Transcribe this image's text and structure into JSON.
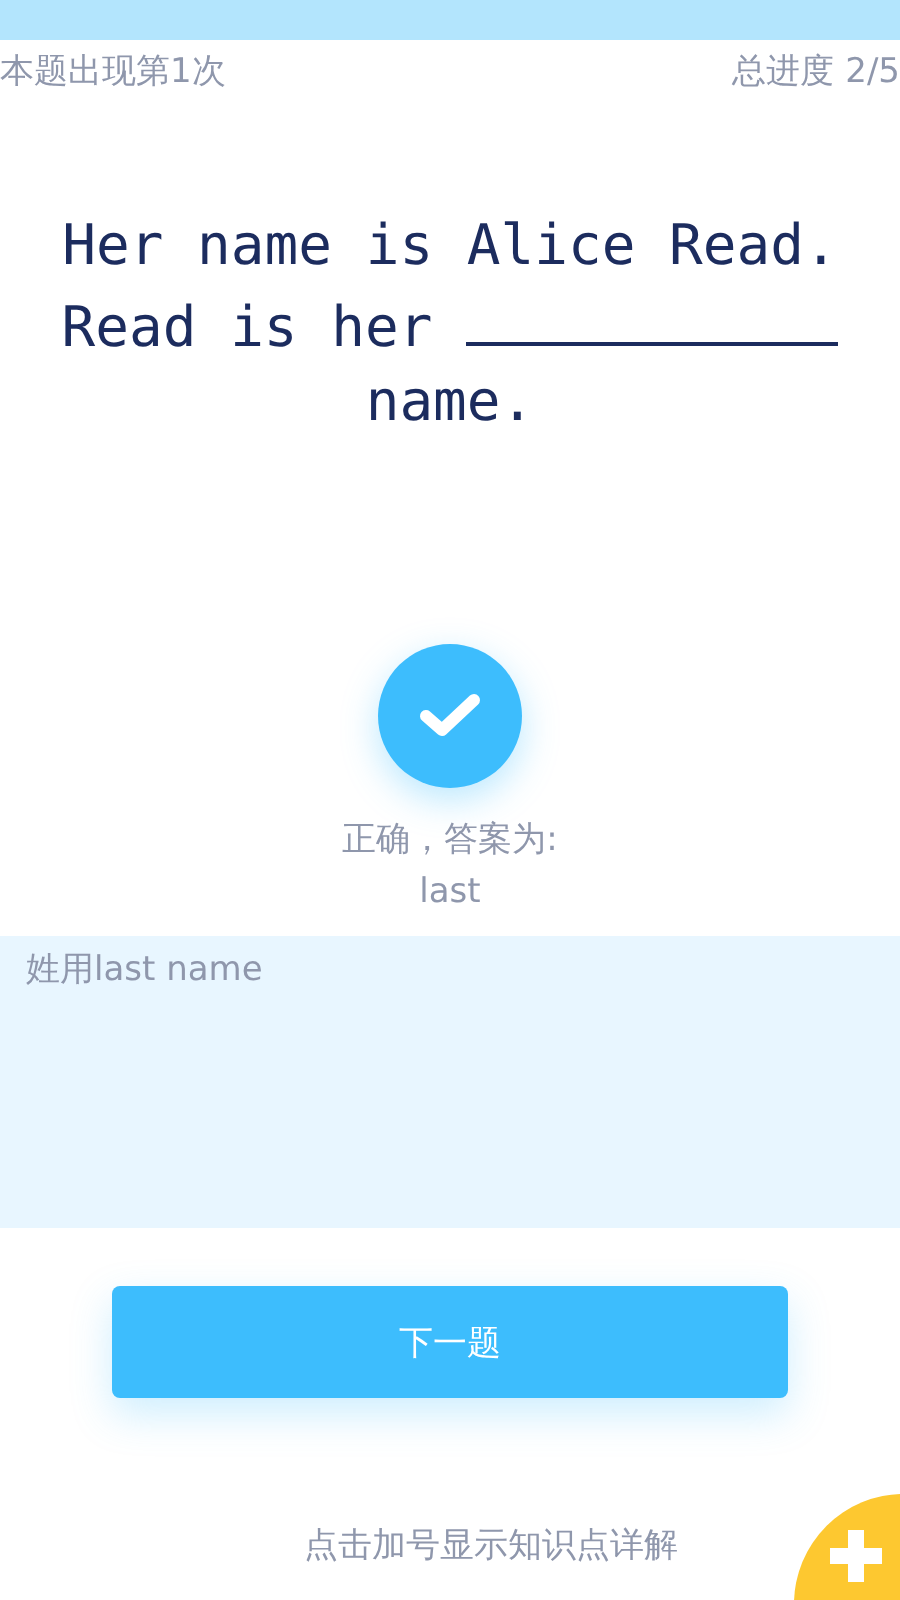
{
  "header": {
    "occurrence": "本题出现第1次",
    "progress_label": "总进度",
    "progress": "2/5"
  },
  "question": {
    "before": "Her name is Alice Read. Read is her",
    "after": "name."
  },
  "result": {
    "correct": true,
    "message": "正确，答案为:",
    "answer": "last"
  },
  "note": "姓用last name",
  "next_button": "下一题",
  "hint": "点击加号显示知识点详解"
}
